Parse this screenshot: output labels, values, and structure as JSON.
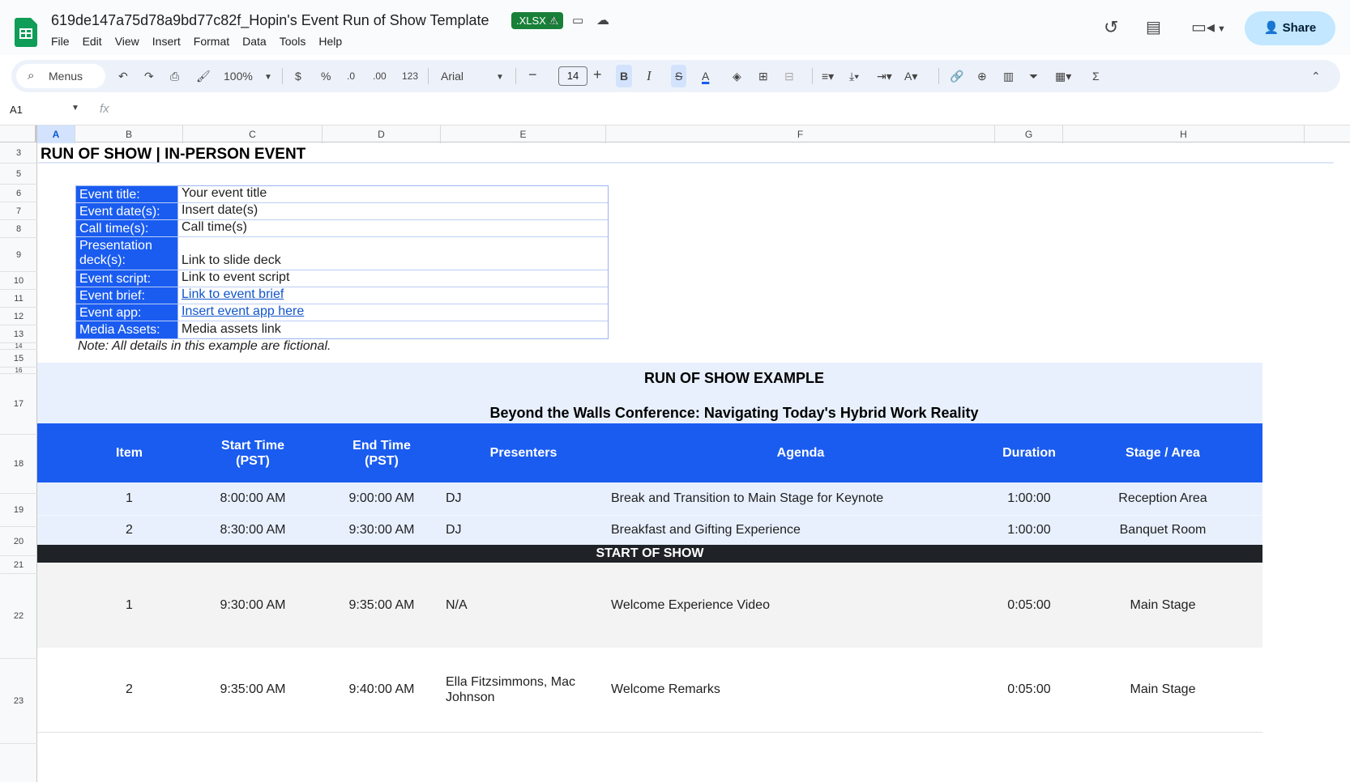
{
  "app": {
    "doc_title": "619de147a75d78a9bd77c82f_Hopin's Event Run of Show Template",
    "file_badge": ".XLSX ⚠",
    "menu": [
      "File",
      "Edit",
      "View",
      "Insert",
      "Format",
      "Data",
      "Tools",
      "Help"
    ],
    "share_label": "Share"
  },
  "toolbar": {
    "menus_search": "Menus",
    "zoom": "100%",
    "currency": "$",
    "percent": "%",
    "dec_decrease": ".0",
    "dec_increase": ".00",
    "number_format": "123",
    "font": "Arial",
    "font_size": "14",
    "bold": "B",
    "italic": "I",
    "strike": "S",
    "text_color": "A",
    "sigma": "Σ"
  },
  "formula_bar": {
    "name_box": "A1",
    "fx": "fx"
  },
  "columns": [
    "A",
    "B",
    "C",
    "D",
    "E",
    "F",
    "G",
    "H"
  ],
  "rows": [
    "3",
    "5",
    "6",
    "7",
    "8",
    "9",
    "10",
    "11",
    "12",
    "13",
    "14",
    "15",
    "16",
    "17",
    "18",
    "19",
    "20",
    "21",
    "22",
    "23"
  ],
  "sheet": {
    "title": "RUN OF SHOW | IN-PERSON EVENT",
    "info": [
      {
        "label": "Event title:",
        "value": "Your event title"
      },
      {
        "label": "Event date(s):",
        "value": "Insert date(s)"
      },
      {
        "label": "Call time(s):",
        "value": "Call time(s)"
      },
      {
        "label": "Presentation deck(s):",
        "value": "Link to slide deck"
      },
      {
        "label": "Event script:",
        "value": "Link to event script"
      },
      {
        "label": "Event brief:",
        "value": "Link to event brief"
      },
      {
        "label": "Event app:",
        "value": "Insert event app here"
      },
      {
        "label": "Media Assets:",
        "value": "Media assets link"
      }
    ],
    "note": "Note: All details in this example are fictional.",
    "example_title": "RUN OF SHOW EXAMPLE",
    "example_subtitle": "Beyond the Walls Conference: Navigating Today's Hybrid Work Reality",
    "schedule_headers": [
      "Item",
      "Start Time (PST)",
      "End Time (PST)",
      "Presenters",
      "Agenda",
      "Duration",
      "Stage / Area"
    ],
    "pre_show": [
      {
        "item": "1",
        "start": "8:00:00 AM",
        "end": "9:00:00 AM",
        "presenters": "DJ",
        "agenda": "Break and Transition to Main Stage for Keynote",
        "duration": "1:00:00",
        "stage": "Reception Area"
      },
      {
        "item": "2",
        "start": "8:30:00 AM",
        "end": "9:30:00 AM",
        "presenters": "DJ",
        "agenda": "Breakfast and Gifting Experience",
        "duration": "1:00:00",
        "stage": "Banquet Room"
      }
    ],
    "start_of_show": "START OF SHOW",
    "show": [
      {
        "item": "1",
        "start": "9:30:00 AM",
        "end": "9:35:00 AM",
        "presenters": "N/A",
        "agenda": "Welcome Experience Video",
        "duration": "0:05:00",
        "stage": "Main Stage"
      },
      {
        "item": "2",
        "start": "9:35:00 AM",
        "end": "9:40:00 AM",
        "presenters": "Ella Fitzsimmons, Mac Johnson",
        "agenda": "Welcome Remarks",
        "duration": "0:05:00",
        "stage": "Main Stage"
      }
    ]
  },
  "colors": {
    "header_blue": "#1a5cf0",
    "band_light": "#e8f0fe",
    "show_dark": "#1f2327",
    "share_bg": "#c2e7ff",
    "sheets_green": "#0f9d58"
  }
}
